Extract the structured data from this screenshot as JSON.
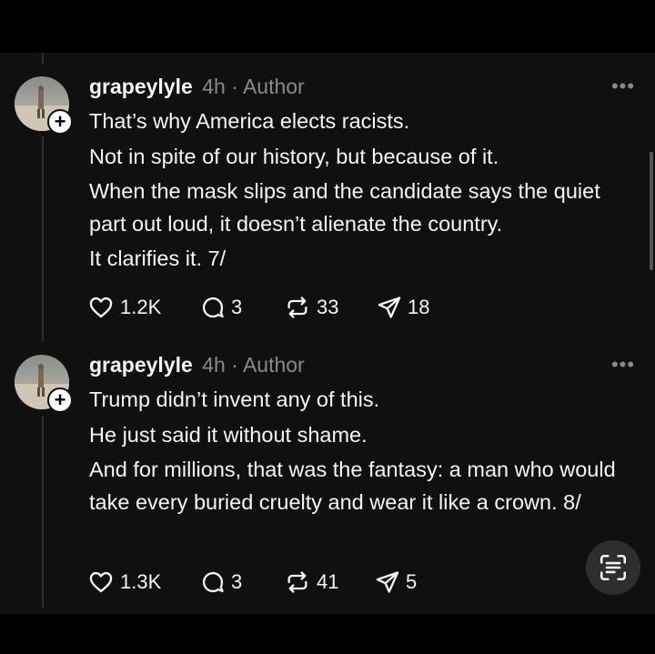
{
  "posts": [
    {
      "username": "grapeylyle",
      "meta": "4h · Author",
      "lines": [
        "That’s why America elects racists.",
        "Not in spite of our history, but because of it.",
        "When the mask slips and the candidate says the quiet part out loud, it doesn’t alienate the country.",
        "It clarifies it. 7/"
      ],
      "likes": "1.2K",
      "replies": "3",
      "reposts": "33",
      "shares": "18"
    },
    {
      "username": "grapeylyle",
      "meta": "4h · Author",
      "lines": [
        "Trump didn’t invent any of this.",
        "He just said it without shame.",
        "And for millions, that was the fantasy: a man who would take every buried cruelty and wear it like a crown. 8/"
      ],
      "likes": "1.3K",
      "replies": "3",
      "reposts": "41",
      "shares": "5"
    }
  ],
  "icons": {
    "more": "more-icon",
    "like": "heart-icon",
    "reply": "comment-icon",
    "repost": "repost-icon",
    "share": "share-icon",
    "scan": "scan-text-icon"
  },
  "colors": {
    "background": "#101010",
    "text": "#f3f5f7",
    "muted": "#8a8a8a"
  }
}
